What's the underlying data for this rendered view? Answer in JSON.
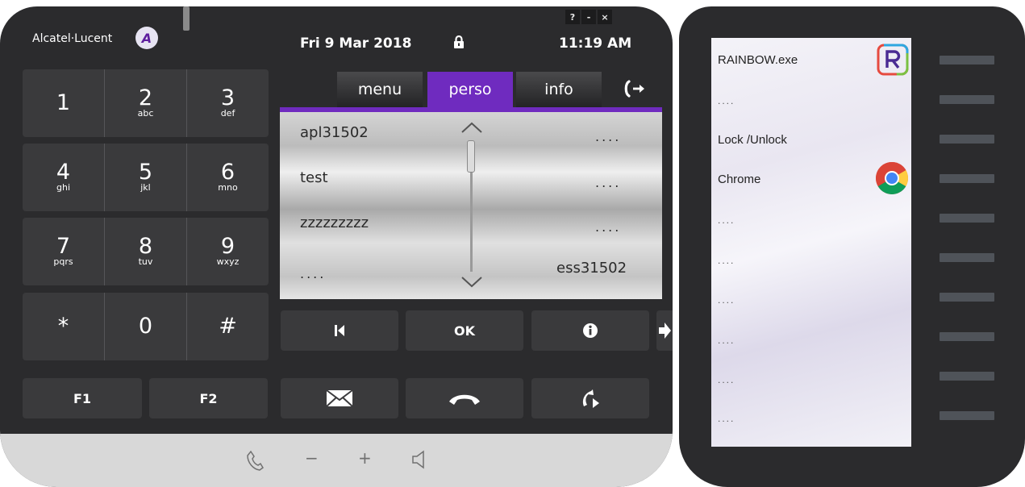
{
  "header": {
    "brand": "Alcatel·Lucent",
    "brand_logo_glyph": "A",
    "date": "Fri 9 Mar 2018",
    "time": "11:19 AM",
    "window_buttons": [
      "?",
      "-",
      "×"
    ]
  },
  "keypad": [
    [
      {
        "digit": "1",
        "letters": ""
      },
      {
        "digit": "2",
        "letters": "abc"
      },
      {
        "digit": "3",
        "letters": "def"
      }
    ],
    [
      {
        "digit": "4",
        "letters": "ghi"
      },
      {
        "digit": "5",
        "letters": "jkl"
      },
      {
        "digit": "6",
        "letters": "mno"
      }
    ],
    [
      {
        "digit": "7",
        "letters": "pqrs"
      },
      {
        "digit": "8",
        "letters": "tuv"
      },
      {
        "digit": "9",
        "letters": "wxyz"
      }
    ],
    [
      {
        "digit": "*",
        "letters": ""
      },
      {
        "digit": "0",
        "letters": ""
      },
      {
        "digit": "#",
        "letters": ""
      }
    ]
  ],
  "tabs": [
    {
      "label": "menu",
      "active": false
    },
    {
      "label": "perso",
      "active": true
    },
    {
      "label": "info",
      "active": false
    }
  ],
  "contacts": {
    "left": [
      "apl31502",
      "test",
      "zzzzzzzzz",
      "...."
    ],
    "right": [
      "....",
      "....",
      "....",
      "ess31502"
    ]
  },
  "nav_buttons": {
    "ok": "OK"
  },
  "function_keys": {
    "f1": "F1",
    "f2": "F2"
  },
  "bottom_controls": {
    "minus": "−",
    "plus": "+"
  },
  "extension": {
    "labels": [
      "RAINBOW.exe",
      "....",
      "Lock /Unlock",
      "Chrome",
      "....",
      "....",
      "....",
      "....",
      "....",
      "...."
    ]
  },
  "icons": {
    "lock": "lock-icon",
    "transfer": "call-transfer-icon",
    "rainbow": "rainbow-app-icon",
    "chrome": "chrome-icon"
  },
  "colors": {
    "accent": "#6f2bbf",
    "body": "#2b2b2d",
    "button": "#3a3a3c"
  }
}
